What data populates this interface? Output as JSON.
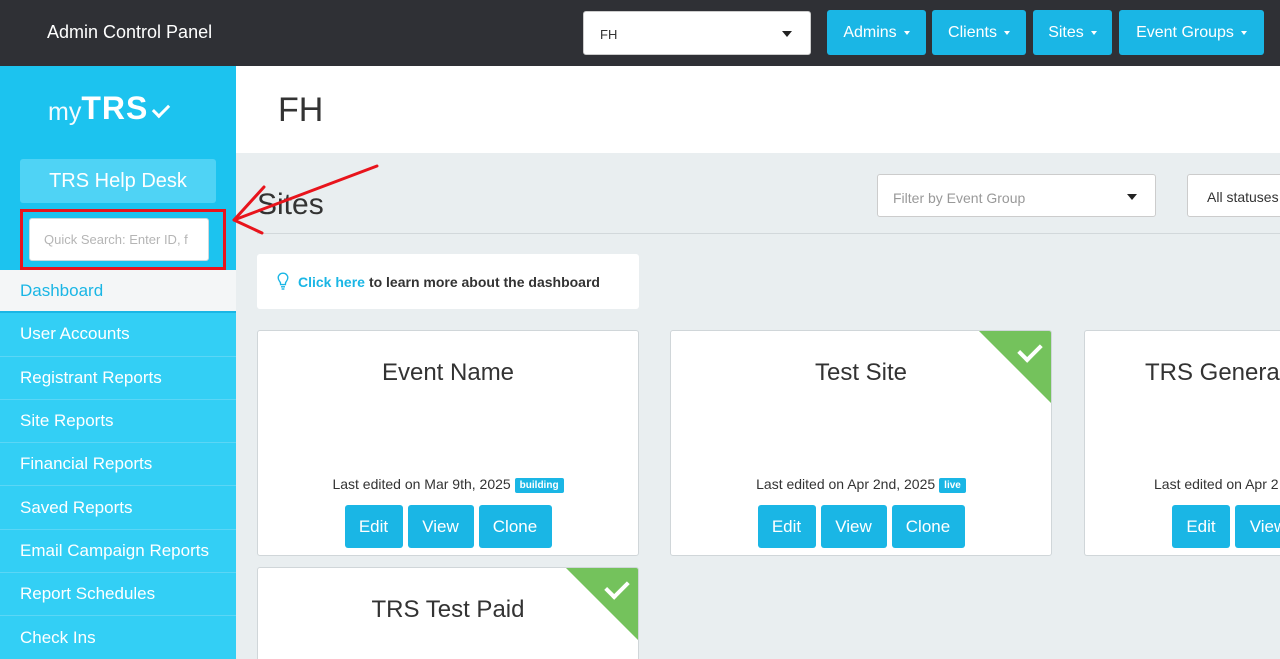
{
  "header": {
    "app_title": "Admin Control Panel",
    "client_select_value": "FH",
    "nav": [
      {
        "label": "Admins"
      },
      {
        "label": "Clients"
      },
      {
        "label": "Sites"
      },
      {
        "label": "Event Groups"
      }
    ]
  },
  "sidebar": {
    "logo_my": "my",
    "logo_trs": "TRS",
    "helpdesk_label": "TRS Help Desk",
    "search_placeholder": "Quick Search: Enter ID, f",
    "items": [
      {
        "label": "Dashboard"
      },
      {
        "label": "User Accounts"
      },
      {
        "label": "Registrant Reports"
      },
      {
        "label": "Site Reports"
      },
      {
        "label": "Financial Reports"
      },
      {
        "label": "Saved Reports"
      },
      {
        "label": "Email Campaign Reports"
      },
      {
        "label": "Report Schedules"
      },
      {
        "label": "Check Ins"
      }
    ]
  },
  "main": {
    "page_title": "FH",
    "section_title": "Sites",
    "filter_placeholder": "Filter by Event Group",
    "status_value": "All statuses",
    "tip_link": "Click here",
    "tip_text": "to learn more about the dashboard",
    "cards": [
      {
        "name": "Event Name",
        "edited": "Last edited on Mar 9th, 2025",
        "badge": "building",
        "live": false
      },
      {
        "name": "Test Site",
        "edited": "Last edited on Apr 2nd, 2025",
        "badge": "live",
        "live": true
      },
      {
        "name": "TRS General",
        "edited": "Last edited on Apr 2",
        "badge": "",
        "live": false
      },
      {
        "name": "TRS Test Paid",
        "edited": "",
        "badge": "",
        "live": true
      }
    ],
    "buttons": {
      "edit": "Edit",
      "view": "View",
      "clone": "Clone"
    }
  },
  "colors": {
    "accent": "#1ab6e5",
    "sidebar": "#1cc3ef",
    "topbar": "#2f3035",
    "live_corner": "#74c25c",
    "annotation": "#e8141c"
  }
}
